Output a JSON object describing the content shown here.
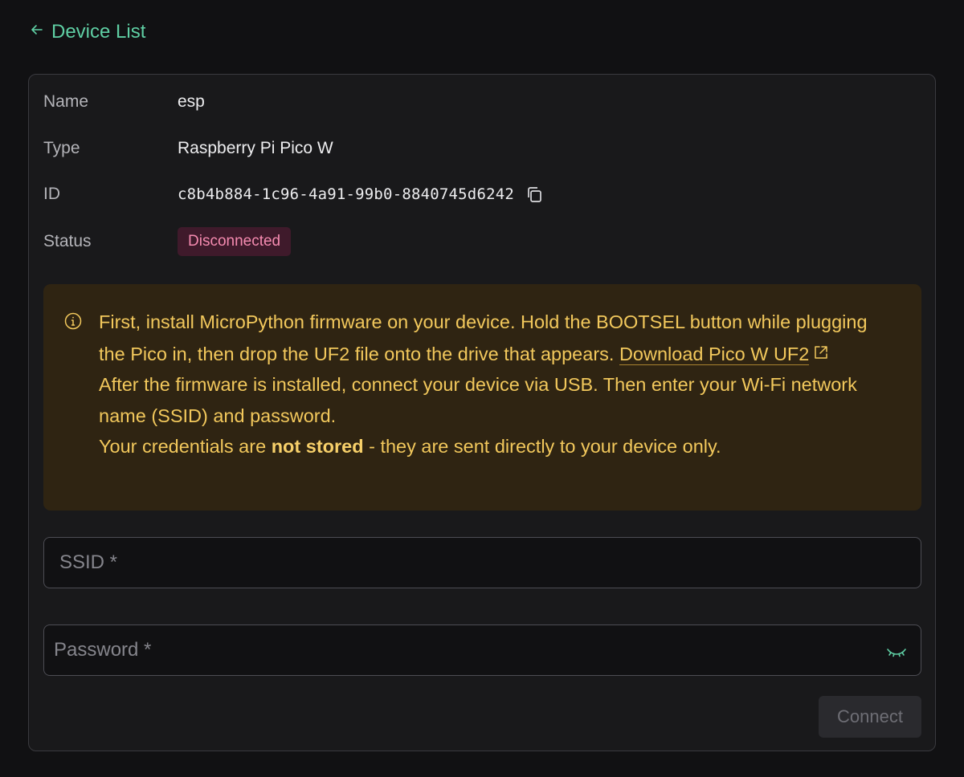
{
  "nav": {
    "back_label": "Device List"
  },
  "device": {
    "name_label": "Name",
    "name_value": "esp",
    "type_label": "Type",
    "type_value": "Raspberry Pi Pico W",
    "id_label": "ID",
    "id_value": "c8b4b884-1c96-4a91-99b0-8840745d6242",
    "status_label": "Status",
    "status_value": "Disconnected"
  },
  "alert": {
    "text_1": "First, install MicroPython firmware on your device. Hold the BOOTSEL button while plugging the Pico in, then drop the UF2 file onto the drive that appears. ",
    "link_label": "Download Pico W UF2",
    "text_2": "After the firmware is installed, connect your device via USB. Then enter your Wi-Fi network name (SSID) and password.",
    "text_3_pre": "Your credentials are ",
    "text_3_bold": "not stored",
    "text_3_post": " - they are sent directly to your device only."
  },
  "form": {
    "ssid_placeholder": "SSID *",
    "password_placeholder": "Password *",
    "connect_label": "Connect"
  },
  "colors": {
    "accent": "#5fcfa4",
    "warning_text": "#f2c85c",
    "warning_bg": "#2f2412",
    "status_bg": "#3f1a2b",
    "status_text": "#f58bb0"
  },
  "icons": {
    "back": "arrow-left-icon",
    "copy": "copy-icon",
    "info": "info-icon",
    "external": "external-link-icon",
    "visibility": "eye-closed-icon"
  }
}
